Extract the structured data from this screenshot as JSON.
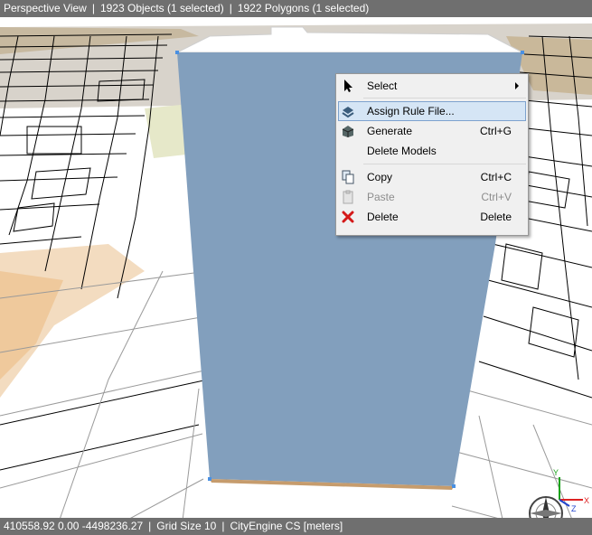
{
  "top_bar": {
    "view_name": "Perspective View",
    "objects": "1923 Objects  (1 selected)",
    "polygons": "1922 Polygons  (1 selected)",
    "separator": "|"
  },
  "context_menu": {
    "items": [
      {
        "label": "Select",
        "icon": "cursor-arrow-icon",
        "shortcut": "",
        "submenu": true
      },
      {
        "label": "Assign Rule File...",
        "icon": "assign-rule-icon",
        "shortcut": "",
        "highlighted": true
      },
      {
        "label": "Generate",
        "icon": "generate-icon",
        "shortcut": "Ctrl+G"
      },
      {
        "label": "Delete Models",
        "icon": "",
        "shortcut": ""
      },
      {
        "label": "Copy",
        "icon": "copy-icon",
        "shortcut": "Ctrl+C"
      },
      {
        "label": "Paste",
        "icon": "paste-icon",
        "shortcut": "Ctrl+V",
        "disabled": true
      },
      {
        "label": "Delete",
        "icon": "delete-red-x-icon",
        "shortcut": "Delete"
      }
    ]
  },
  "bottom_bar": {
    "coordinates": "410558.92 0.00 -4498236.27",
    "grid_size": "Grid Size 10",
    "coord_system": "CityEngine CS [meters]",
    "separator": "|"
  },
  "axis_gizmo": {
    "x": "X",
    "y": "Y",
    "z": "Z"
  },
  "colors": {
    "building": "#829fbd",
    "status_bar": "#6f6f6f",
    "menu_bg": "#f0f0f0",
    "menu_highlight": "#d5e5f5",
    "vertex": "#4a90e2"
  }
}
